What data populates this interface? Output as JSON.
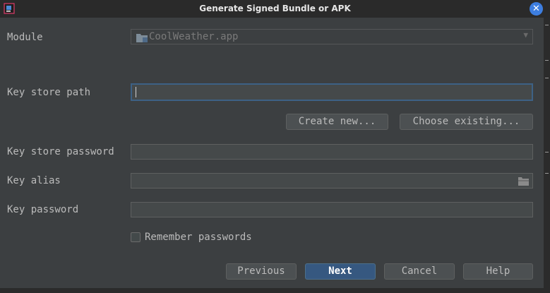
{
  "window": {
    "title": "Generate Signed Bundle or APK"
  },
  "module": {
    "label": "Module",
    "value": "CoolWeather.app"
  },
  "key_store_path": {
    "label": "Key store path",
    "value": ""
  },
  "key_store_buttons": {
    "create_new": "Create new...",
    "choose_existing": "Choose existing..."
  },
  "key_store_password": {
    "label": "Key store password",
    "value": ""
  },
  "key_alias": {
    "label": "Key alias",
    "value": ""
  },
  "key_password": {
    "label": "Key password",
    "value": ""
  },
  "remember": {
    "label": "Remember passwords",
    "checked": false
  },
  "footer": {
    "previous": "Previous",
    "next": "Next",
    "cancel": "Cancel",
    "help": "Help"
  },
  "colors": {
    "accent": "#3d7ee0",
    "default_button": "#365880",
    "background": "#3c3f41"
  }
}
